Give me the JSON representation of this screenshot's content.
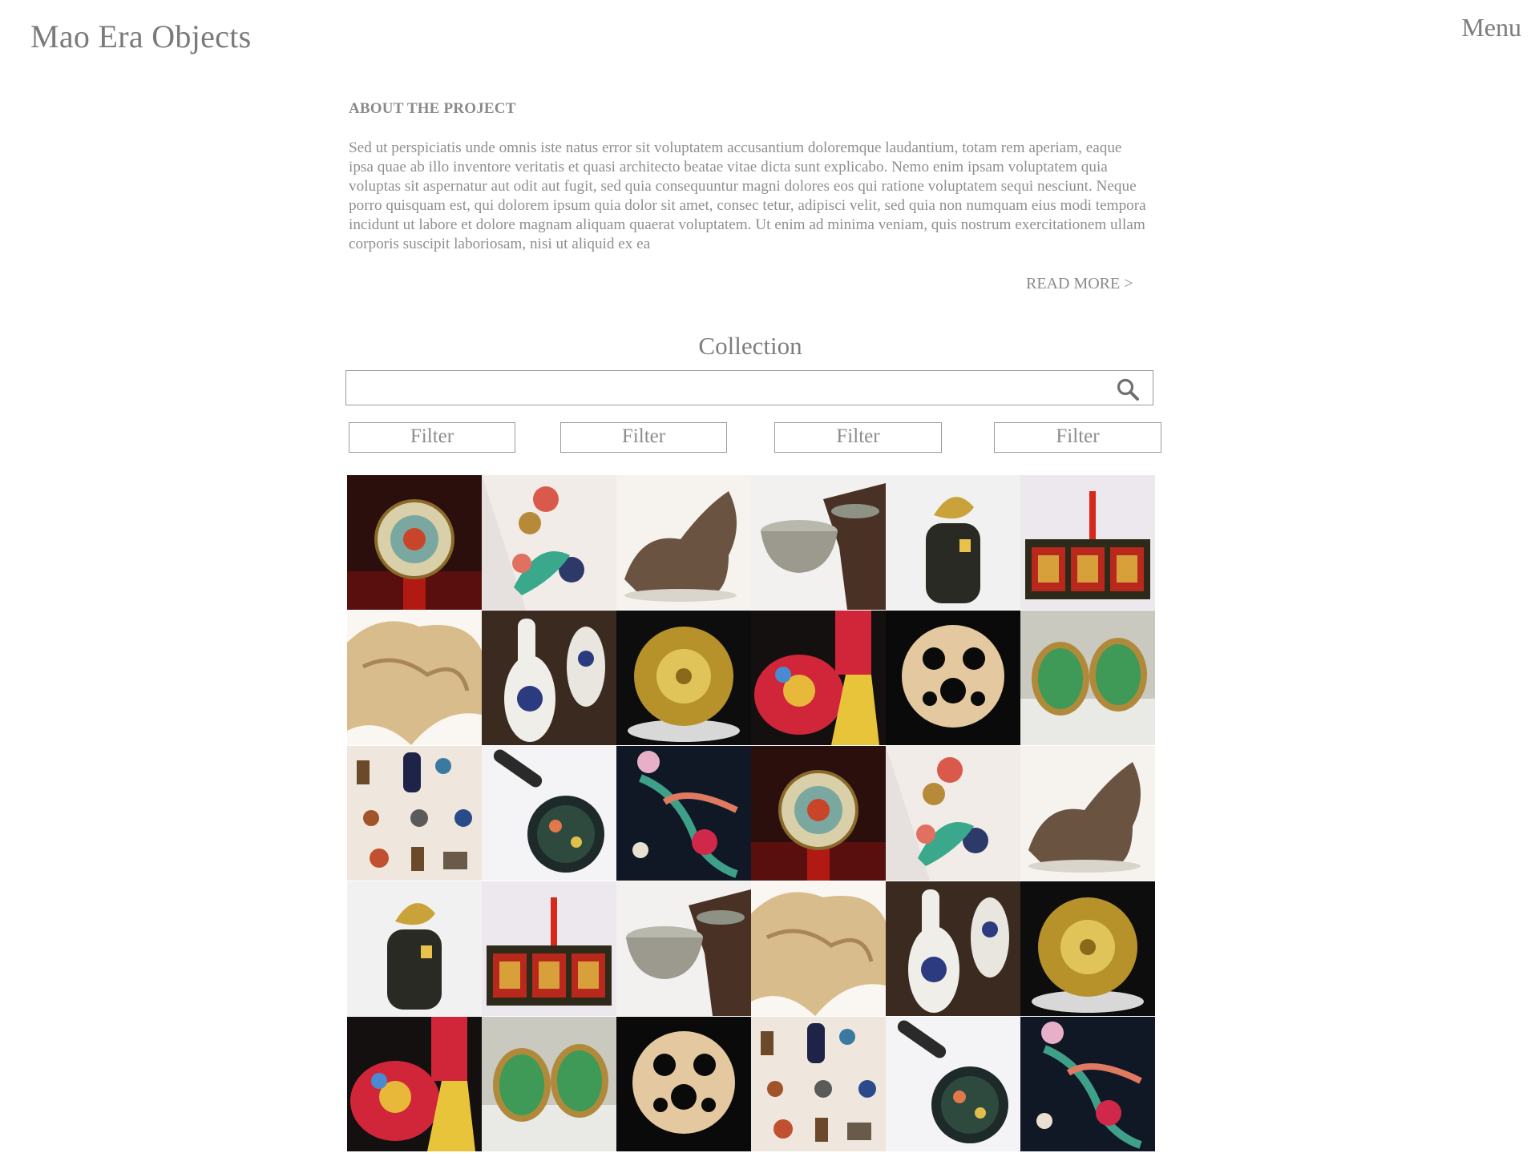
{
  "header": {
    "title": "Mao Era Objects",
    "menu_label": "Menu"
  },
  "about": {
    "heading": "ABOUT THE PROJECT",
    "body": "Sed ut perspiciatis unde omnis iste natus error sit voluptatem accusantium doloremque laudantium, totam rem aperiam, eaque ipsa quae ab illo inventore veritatis et quasi architecto beatae vitae dicta sunt explicabo. Nemo enim ipsam voluptatem quia voluptas sit aspernatur aut odit aut fugit, sed quia consequuntur magni dolores eos qui ratione voluptatem sequi nesciunt. Neque porro quisquam est, qui dolorem ipsum quia dolor sit amet, consec tetur, adipisci velit, sed quia non numquam eius modi tempora incidunt ut labore et dolore magnam aliquam quaerat voluptatem. Ut enim ad minima veniam, quis nostrum exercitationem ullam corporis suscipit laboriosam, nisi ut aliquid ex ea",
    "read_more": "READ MORE >"
  },
  "collection": {
    "title": "Collection",
    "search": {
      "value": "",
      "placeholder": "",
      "icon": "search-icon"
    },
    "filters": [
      "Filter",
      "Filter",
      "Filter",
      "Filter"
    ],
    "items": [
      "dragon-medallion",
      "porcelain-flower-vase",
      "bronze-ox",
      "celadon-bowl",
      "goldfish-lid-jar",
      "lacquered-cabinet",
      "carved-root-sculpture",
      "blue-white-spoons",
      "gilded-rosette-plate",
      "famille-rose-vase",
      "carved-jade-pendant",
      "jade-cufflinks",
      "miniature-objects-set",
      "cloisonne-compact",
      "phoenix-embroidery",
      "dragon-medallion",
      "porcelain-flower-vase",
      "bronze-ox",
      "goldfish-lid-jar",
      "lacquered-cabinet",
      "celadon-bowl",
      "carved-root-sculpture",
      "blue-white-spoons",
      "gilded-rosette-plate",
      "famille-rose-vase",
      "jade-cufflinks",
      "carved-jade-pendant",
      "miniature-objects-set",
      "cloisonne-compact",
      "phoenix-embroidery"
    ]
  }
}
